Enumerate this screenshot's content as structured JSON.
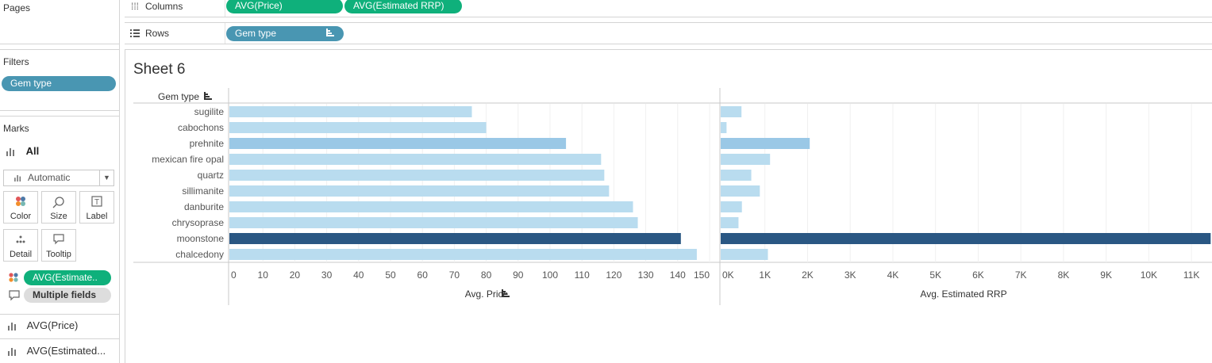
{
  "left_panel": {
    "pages_title": "Pages",
    "filters_title": "Filters",
    "filter_pill": "Gem type",
    "marks_title": "Marks",
    "marks_all": "All",
    "mark_type": "Automatic",
    "buttons": {
      "color": "Color",
      "size": "Size",
      "label": "Label",
      "detail": "Detail",
      "tooltip": "Tooltip"
    },
    "color_pill": "AVG(Estimate..",
    "tooltip_pill": "Multiple fields",
    "measure_1": "AVG(Price)",
    "measure_2": "AVG(Estimated..."
  },
  "shelves": {
    "columns_label": "Columns",
    "columns_pills": [
      "AVG(Price)",
      "AVG(Estimated RRP)"
    ],
    "rows_label": "Rows",
    "rows_pill": "Gem type"
  },
  "sheet": {
    "title": "Sheet 6"
  },
  "colors": {
    "green_pill": "#0fb07b",
    "blue_pill": "#4996b2",
    "bar_light": "#b9dcef",
    "bar_mid": "#9ac8e6",
    "bar_dark": "#2a5783"
  },
  "chart_data": {
    "type": "bar",
    "orientation": "horizontal",
    "row_header": "Gem type",
    "categories": [
      "sugilite",
      "cabochons",
      "prehnite",
      "mexican fire opal",
      "quartz",
      "sillimanite",
      "danburite",
      "chrysoprase",
      "moonstone",
      "chalcedony"
    ],
    "series": [
      {
        "name": "Avg. Price",
        "values": [
          75.5,
          80,
          105,
          116,
          117,
          118.5,
          126,
          127.5,
          141,
          146
        ],
        "xlim": [
          0,
          150
        ],
        "ticks": [
          "0",
          "10",
          "20",
          "30",
          "40",
          "50",
          "60",
          "70",
          "80",
          "90",
          "100",
          "110",
          "120",
          "130",
          "140",
          "150"
        ]
      },
      {
        "name": "Avg. Estimated RRP",
        "values": [
          450,
          100,
          2050,
          1120,
          680,
          880,
          460,
          380,
          11450,
          1070
        ],
        "xlim": [
          0,
          11500
        ],
        "ticks": [
          "0K",
          "1K",
          "2K",
          "3K",
          "4K",
          "5K",
          "6K",
          "7K",
          "8K",
          "9K",
          "10K",
          "11K"
        ]
      }
    ],
    "color_encoding": "AVG(Estimated RRP)",
    "grid": true
  }
}
